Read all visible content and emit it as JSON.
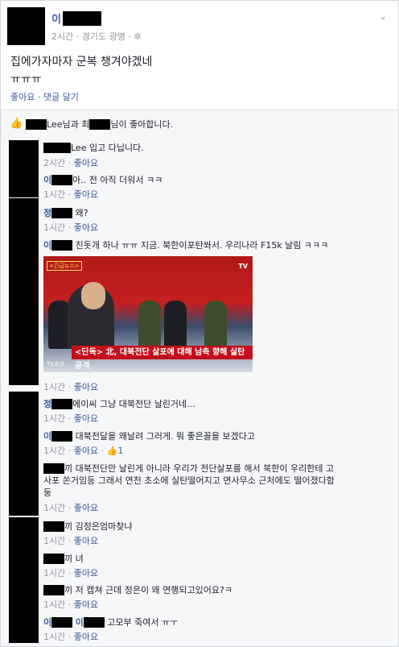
{
  "post": {
    "author": "이",
    "meta": "2시간 · 경기도 광명 · ✲",
    "text_line1": "집에가자마자 군복 챙겨야겠네",
    "text_line2": "ㅠㅠㅠ",
    "like_action": "좋아요",
    "comment_action": "댓글 달기"
  },
  "likes_bar": {
    "part1": "Lee님과 최",
    "part2": "님이 좋아합니다."
  },
  "image": {
    "chyron": "<단독> 北, 대북전단 살포에 대해 남측 향해 실탄 공격",
    "logo": "TV조선",
    "tag": "<긴급뉴스>"
  },
  "comments": [
    {
      "name": "",
      "text": "Lee 입고 다닙니다.",
      "time": "2시간",
      "like": "좋아요"
    },
    {
      "name": "이",
      "text": "아.. 전 아직 더워서 ㅋㅋ",
      "time": "1시간",
      "like": "좋아요"
    },
    {
      "name": "정",
      "text": "왜?",
      "time": "1시간",
      "like": "좋아요"
    },
    {
      "name": "이",
      "text": "진돗개 하나 ㅠㅠ 지금. 북한이포탄쏴서. 우리나라 F15k 날림 ㅋㅋㅋ",
      "time": "1시간",
      "like": "좋아요"
    },
    {
      "name": "정",
      "text": "에이씨 그냥 대북전단 날린거네...",
      "time": "1시간",
      "like": "좋아요"
    },
    {
      "name": "이",
      "text": "대북전달을 왜날려 그러게. 뭐 좋은꼴을 보겠다고",
      "time": "1시간",
      "like": "좋아요",
      "like_count": "1"
    },
    {
      "name": "",
      "text1": "끼 대북전단만 날린게 아니라 우리가 전단살포를 해서 북한이 우리한테 고",
      "text2": "사포 쏜거임등 그래서 연천 초소에 실탄떨어지고 면사무소 근처에도 떨어졌다함",
      "text3": "둥",
      "time": "1시간",
      "like": "좋아요"
    },
    {
      "name": "",
      "text": "끼 김정은엄마찾냐",
      "time": "1시간",
      "like": "좋아요"
    },
    {
      "name": "",
      "text": "끼 녀",
      "time": "1시간",
      "like": "좋아요"
    },
    {
      "name": "",
      "text": "끼 저 캡쳐 근데 정은이 왜 연행되고있어요?ㅋ",
      "time": "1시간",
      "like": "좋아요"
    },
    {
      "name": "이",
      "prefix": "이",
      "text": "고모부 죽여서 ㅠㅜ",
      "time": "1시간",
      "like": "좋아요"
    }
  ]
}
